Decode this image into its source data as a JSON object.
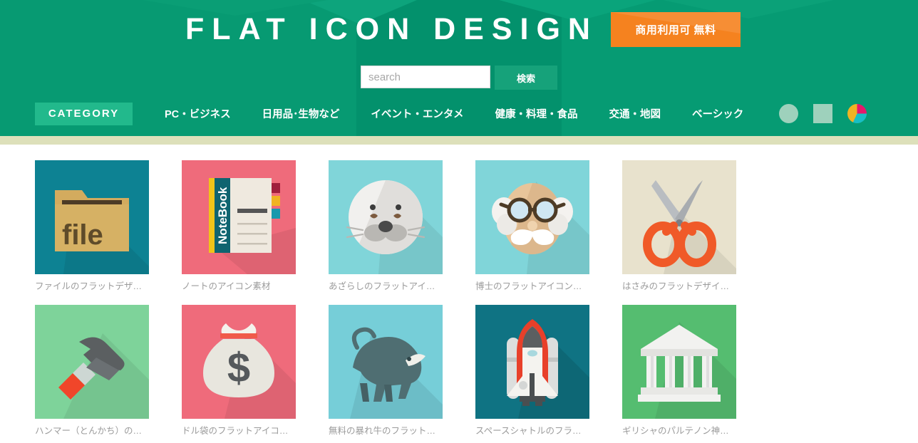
{
  "header": {
    "site_title": "FLAT ICON DESIGN",
    "badge_text": "商用利用可 無料",
    "badge_color": "#f5821f",
    "background_color": "#009b72"
  },
  "search": {
    "placeholder": "search",
    "value": "",
    "button_label": "検索"
  },
  "nav": {
    "category_label": "CATEGORY",
    "items": [
      {
        "label": "PC・ビジネス"
      },
      {
        "label": "日用品･生物など"
      },
      {
        "label": "イベント・エンタメ"
      },
      {
        "label": "健康・料理・食品"
      },
      {
        "label": "交通・地図"
      },
      {
        "label": "ベーシック"
      }
    ],
    "shape_icons": [
      {
        "name": "circle-shape-icon",
        "color": "#9ed1bc"
      },
      {
        "name": "square-shape-icon",
        "color": "#9ed1bc"
      },
      {
        "name": "pie-chart-shape-icon",
        "color": "#e6176b"
      }
    ]
  },
  "grid": {
    "items": [
      {
        "label": "ファイルのフラットデザ…",
        "icon": "file-folder-icon",
        "bg": "#0d8293"
      },
      {
        "label": "ノートのアイコン素材",
        "icon": "notebook-icon",
        "bg": "#ef6b7b"
      },
      {
        "label": "あざらしのフラットアイ…",
        "icon": "seal-face-icon",
        "bg": "#80d5d9"
      },
      {
        "label": "博士のフラットアイコン…",
        "icon": "professor-face-icon",
        "bg": "#80d5d9"
      },
      {
        "label": "はさみのフラットデザイ…",
        "icon": "scissors-icon",
        "bg": "#e8e2cd"
      },
      {
        "label": "ハンマー（とんかち）の…",
        "icon": "hammer-icon",
        "bg": "#7ed39a"
      },
      {
        "label": "ドル袋のフラットアイコ…",
        "icon": "money-bag-icon",
        "bg": "#ef6b7b"
      },
      {
        "label": "無料の暴れ牛のフラット…",
        "icon": "bull-icon",
        "bg": "#76ced8"
      },
      {
        "label": "スペースシャトルのフラ…",
        "icon": "space-shuttle-icon",
        "bg": "#0f7383"
      },
      {
        "label": "ギリシャのパルテノン神…",
        "icon": "parthenon-icon",
        "bg": "#55bd70"
      }
    ]
  }
}
